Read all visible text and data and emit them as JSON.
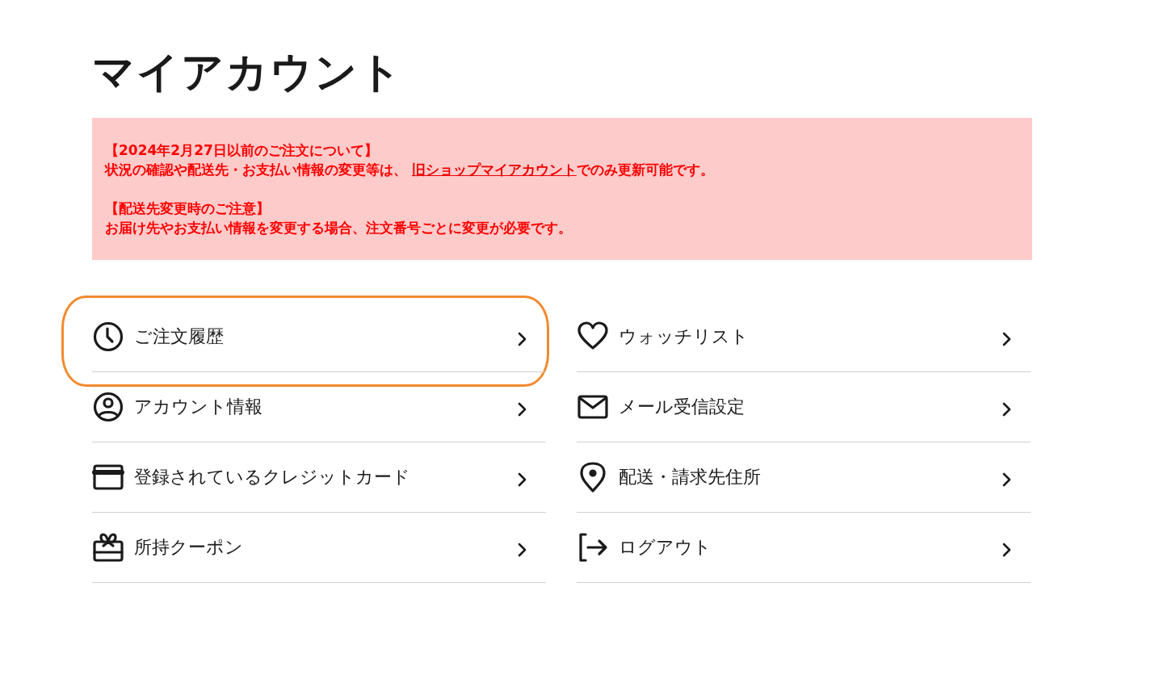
{
  "title": "マイアカウント",
  "notice": [
    {
      "heading": "【2024年2月27日以前のご注文について】",
      "before": "状況の確認や配送先・お支払い情報の変更等は、 ",
      "link": "旧ショップマイアカウント",
      "after": "でのみ更新可能です。"
    },
    {
      "heading": "【配送先変更時のご注意】",
      "before": "お届け先やお支払い情報を変更する場合、注文番号ごとに変更が必要です。"
    }
  ],
  "menu": [
    {
      "label": "ご注文履歴",
      "kind": "clock",
      "highlighted": true
    },
    {
      "label": "ウォッチリスト",
      "kind": "heart",
      "highlighted": false
    },
    {
      "label": "アカウント情報",
      "kind": "user",
      "highlighted": false
    },
    {
      "label": "メール受信設定",
      "kind": "mail",
      "highlighted": false
    },
    {
      "label": "登録されているクレジットカード",
      "kind": "card",
      "highlighted": false
    },
    {
      "label": "配送・請求先住所",
      "kind": "pin",
      "highlighted": false
    },
    {
      "label": "所持クーポン",
      "kind": "gift",
      "highlighted": false
    },
    {
      "label": "ログアウト",
      "kind": "logout",
      "highlighted": false
    }
  ]
}
